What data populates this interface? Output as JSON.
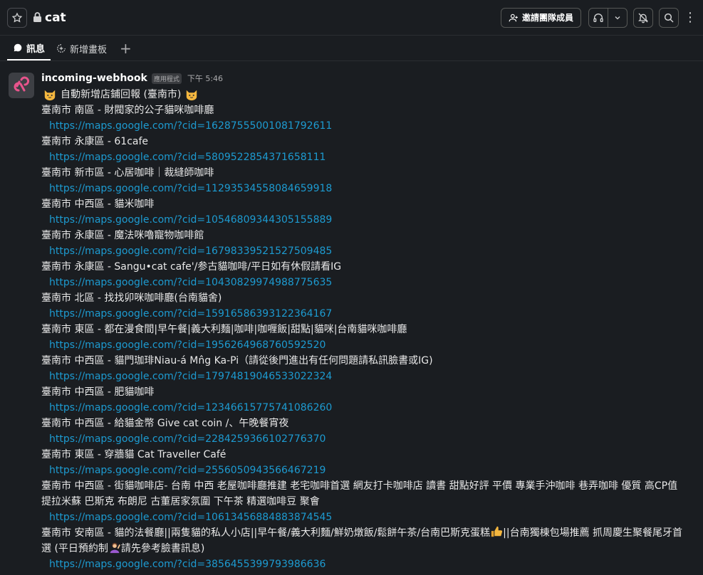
{
  "header": {
    "channel_name": "cat",
    "invite_label": "邀請團隊成員"
  },
  "tabs": {
    "messages_label": "訊息",
    "canvas_label": "新增畫板",
    "add_label": "+"
  },
  "message": {
    "sender": "incoming-webhook",
    "badge": "應用程式",
    "time": "下午 5:46",
    "title": "自動新增店鋪回報 (臺南市)",
    "entries": [
      {
        "name": "臺南市 南區 - 財閥家的公子貓咪咖啡廳",
        "url": "https://maps.google.com/?cid=16287555001081792611"
      },
      {
        "name": "臺南市 永康區 - 61cafe",
        "url": "https://maps.google.com/?cid=5809522854371658111"
      },
      {
        "name": "臺南市 新市區 - 心居咖啡｜裁縫師咖啡",
        "url": "https://maps.google.com/?cid=11293534558084659918"
      },
      {
        "name": "臺南市 中西區 - 貓米咖啡",
        "url": "https://maps.google.com/?cid=10546809344305155889"
      },
      {
        "name": "臺南市 永康區 - 魔法咪嚕寵物咖啡館",
        "url": "https://maps.google.com/?cid=16798339521527509485"
      },
      {
        "name": "臺南市 永康區 - Sangu•cat cafe'/参古貓咖啡/平日如有休假請看IG",
        "url": "https://maps.google.com/?cid=10430829974988775635"
      },
      {
        "name": "臺南市 北區 - 找找卯咪咖啡廳(台南貓舍)",
        "url": "https://maps.google.com/?cid=15916586393122364167"
      },
      {
        "name": "臺南市 東區 - 都在漫食間|早午餐|義大利麵|咖啡|咖喱飯|甜點|貓咪|台南貓咪咖啡廳",
        "url": "https://maps.google.com/?cid=1956264968760592520"
      },
      {
        "name": "臺南市 中西區 - 貓門珈琲Niau-á Mn̂g Ka-Pi（請從後門進出有任何問題請私訊臉書或IG)",
        "url": "https://maps.google.com/?cid=17974819046533022324"
      },
      {
        "name": "臺南市 中西區 - 肥貓咖啡",
        "url": "https://maps.google.com/?cid=12346615775741086260"
      },
      {
        "name": "臺南市 中西區 - 給貓金幣 Give cat coin /、午晚餐宵夜",
        "url": "https://maps.google.com/?cid=2284259366102776370"
      },
      {
        "name": "臺南市 東區 - 穿牆貓 Cat Traveller Café",
        "url": "https://maps.google.com/?cid=2556050943566467219"
      },
      {
        "name": "臺南市 中西區 - 街貓咖啡店- 台南 中西 老屋咖啡廳推建 老宅咖啡首選 網友打卡咖啡店 讀書 甜點好評 平價 專業手沖咖啡 巷弄咖啡 優質 高CP值 提拉米蘇 巴斯克 布朗尼 古董居家氛圍 下午茶 精選咖啡豆 聚會",
        "url": "https://maps.google.com/?cid=10613456884883874545"
      }
    ],
    "last_entry": {
      "part1": "臺南市 安南區 - 貓的法餐廳||兩隻貓的私人小店||早午餐/義大利麵/鮮奶燉飯/鬆餅午茶/台南巴斯克蛋糕",
      "part2": "||台南獨棟包場推薦 抓周慶生聚餐尾牙首選 (平日預約制",
      "part3": "請先參考臉書訊息)",
      "url": "https://maps.google.com/?cid=3856455399793986636"
    }
  },
  "icons": {
    "star": "star-icon",
    "lock": "lock-icon",
    "add_user": "add-user-icon",
    "headphones": "headphones-icon",
    "chevron": "chevron-down-icon",
    "bell": "bell-off-icon",
    "search": "search-icon",
    "more": "more-vertical-icon"
  }
}
